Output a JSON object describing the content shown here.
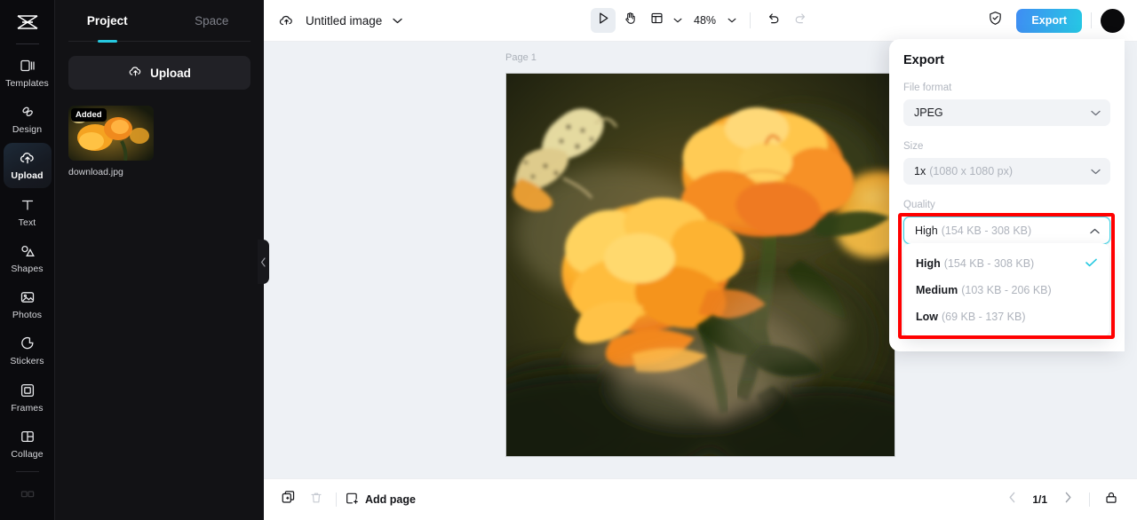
{
  "rail": {
    "logo_icon": "capcut-logo-icon",
    "items": [
      {
        "label": "Templates",
        "icon": "templates-icon"
      },
      {
        "label": "Design",
        "icon": "design-icon"
      },
      {
        "label": "Upload",
        "icon": "upload-cloud-icon",
        "active": true
      },
      {
        "label": "Text",
        "icon": "text-icon"
      },
      {
        "label": "Shapes",
        "icon": "shapes-icon"
      },
      {
        "label": "Photos",
        "icon": "photos-icon"
      },
      {
        "label": "Stickers",
        "icon": "stickers-icon"
      },
      {
        "label": "Frames",
        "icon": "frames-icon"
      },
      {
        "label": "Collage",
        "icon": "collage-icon"
      }
    ]
  },
  "panel": {
    "tabs": [
      {
        "label": "Project",
        "active": true
      },
      {
        "label": "Space",
        "active": false
      }
    ],
    "upload_label": "Upload",
    "asset": {
      "badge": "Added",
      "filename": "download.jpg"
    }
  },
  "topbar": {
    "cloud_icon": "cloud-save-icon",
    "doc_title": "Untitled image",
    "title_caret_icon": "chevron-down-icon",
    "tools": [
      {
        "name": "select-tool",
        "icon": "cursor-arrow-icon",
        "selected": true
      },
      {
        "name": "hand-tool",
        "icon": "hand-icon",
        "selected": false
      },
      {
        "name": "layout-tool",
        "icon": "layout-grid-icon",
        "selected": false
      }
    ],
    "zoom_level": "48%",
    "undo_icon": "undo-icon",
    "redo_icon": "redo-icon",
    "shield_icon": "shield-check-icon",
    "export_label": "Export",
    "avatar_name": "user-avatar"
  },
  "canvas": {
    "page_label": "Page 1"
  },
  "bottombar": {
    "duplicate_icon": "duplicate-page-icon",
    "delete_icon": "trash-icon",
    "add_page_label": "Add page",
    "prev_icon": "chevron-left-icon",
    "page_indicator": "1/1",
    "next_icon": "chevron-right-icon",
    "lock_icon": "lock-icon"
  },
  "export_panel": {
    "title": "Export",
    "file_format": {
      "label": "File format",
      "value": "JPEG"
    },
    "size": {
      "label": "Size",
      "value_main": "1x",
      "value_sub": "(1080 x 1080 px)"
    },
    "quality": {
      "label": "Quality",
      "selected_main": "High",
      "selected_sub": "(154 KB - 308 KB)",
      "expanded": true,
      "options": [
        {
          "main": "High",
          "sub": "(154 KB - 308 KB)",
          "checked": true
        },
        {
          "main": "Medium",
          "sub": "(103 KB - 206 KB)",
          "checked": false
        },
        {
          "main": "Low",
          "sub": "(69 KB - 137 KB)",
          "checked": false
        }
      ]
    }
  },
  "colors": {
    "accent_cyan": "#26c8e0",
    "export_gradient_from": "#3f8df3",
    "export_gradient_to": "#26c8e4",
    "annotation_red": "#ff0000",
    "canvas_bg": "#eef1f5",
    "rail_bg": "#0b0b0e",
    "panel_bg": "#121215"
  }
}
